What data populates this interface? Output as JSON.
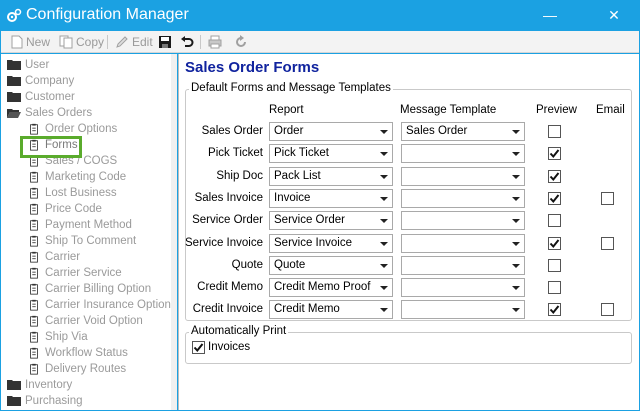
{
  "window": {
    "title": "Configuration Manager",
    "minimize": "—",
    "close": "✕"
  },
  "toolbar": {
    "new_label": "New",
    "copy_label": "Copy",
    "edit_label": "Edit"
  },
  "tree": {
    "items": [
      {
        "label": "User",
        "kind": "folder"
      },
      {
        "label": "Company",
        "kind": "folder"
      },
      {
        "label": "Customer",
        "kind": "folder"
      },
      {
        "label": "Sales Orders",
        "kind": "folder-open"
      },
      {
        "label": "Order Options",
        "kind": "doc"
      },
      {
        "label": "Forms",
        "kind": "doc"
      },
      {
        "label": "Sales / COGS",
        "kind": "doc"
      },
      {
        "label": "Marketing Code",
        "kind": "doc"
      },
      {
        "label": "Lost Business",
        "kind": "doc"
      },
      {
        "label": "Price Code",
        "kind": "doc"
      },
      {
        "label": "Payment Method",
        "kind": "doc"
      },
      {
        "label": "Ship To Comment",
        "kind": "doc"
      },
      {
        "label": "Carrier",
        "kind": "doc"
      },
      {
        "label": "Carrier Service",
        "kind": "doc"
      },
      {
        "label": "Carrier Billing Option",
        "kind": "doc"
      },
      {
        "label": "Carrier Insurance Option",
        "kind": "doc"
      },
      {
        "label": "Carrier Void Option",
        "kind": "doc"
      },
      {
        "label": "Ship Via",
        "kind": "doc"
      },
      {
        "label": "Workflow Status",
        "kind": "doc"
      },
      {
        "label": "Delivery Routes",
        "kind": "doc"
      },
      {
        "label": "Inventory",
        "kind": "folder"
      },
      {
        "label": "Purchasing",
        "kind": "folder"
      }
    ],
    "selected": "Forms"
  },
  "main": {
    "title": "Sales Order Forms",
    "group_forms_label": "Default Forms and Message Templates",
    "columns": {
      "report": "Report",
      "message_template": "Message Template",
      "preview": "Preview",
      "email": "Email"
    },
    "rows": [
      {
        "label": "Sales Order",
        "report": "Order",
        "template": "Sales Order",
        "preview": false,
        "email": null
      },
      {
        "label": "Pick Ticket",
        "report": "Pick Ticket",
        "template": "",
        "preview": true,
        "email": null
      },
      {
        "label": "Ship Doc",
        "report": "Pack List",
        "template": "",
        "preview": true,
        "email": null
      },
      {
        "label": "Sales Invoice",
        "report": "Invoice",
        "template": "",
        "preview": true,
        "email": false
      },
      {
        "label": "Service Order",
        "report": "Service Order",
        "template": "",
        "preview": false,
        "email": null
      },
      {
        "label": "Service Invoice",
        "report": "Service Invoice",
        "template": "",
        "preview": true,
        "email": false
      },
      {
        "label": "Quote",
        "report": "Quote",
        "template": "",
        "preview": false,
        "email": null
      },
      {
        "label": "Credit Memo",
        "report": "Credit Memo Proof",
        "template": "",
        "preview": false,
        "email": null
      },
      {
        "label": "Credit Invoice",
        "report": "Credit Memo",
        "template": "",
        "preview": true,
        "email": false
      }
    ],
    "group_print_label": "Automatically Print",
    "auto_print": {
      "label": "Invoices",
      "checked": true
    }
  },
  "colors": {
    "titlebar": "#1ba1e2",
    "heading": "#10239e",
    "selection_outline": "#5aab2c"
  }
}
